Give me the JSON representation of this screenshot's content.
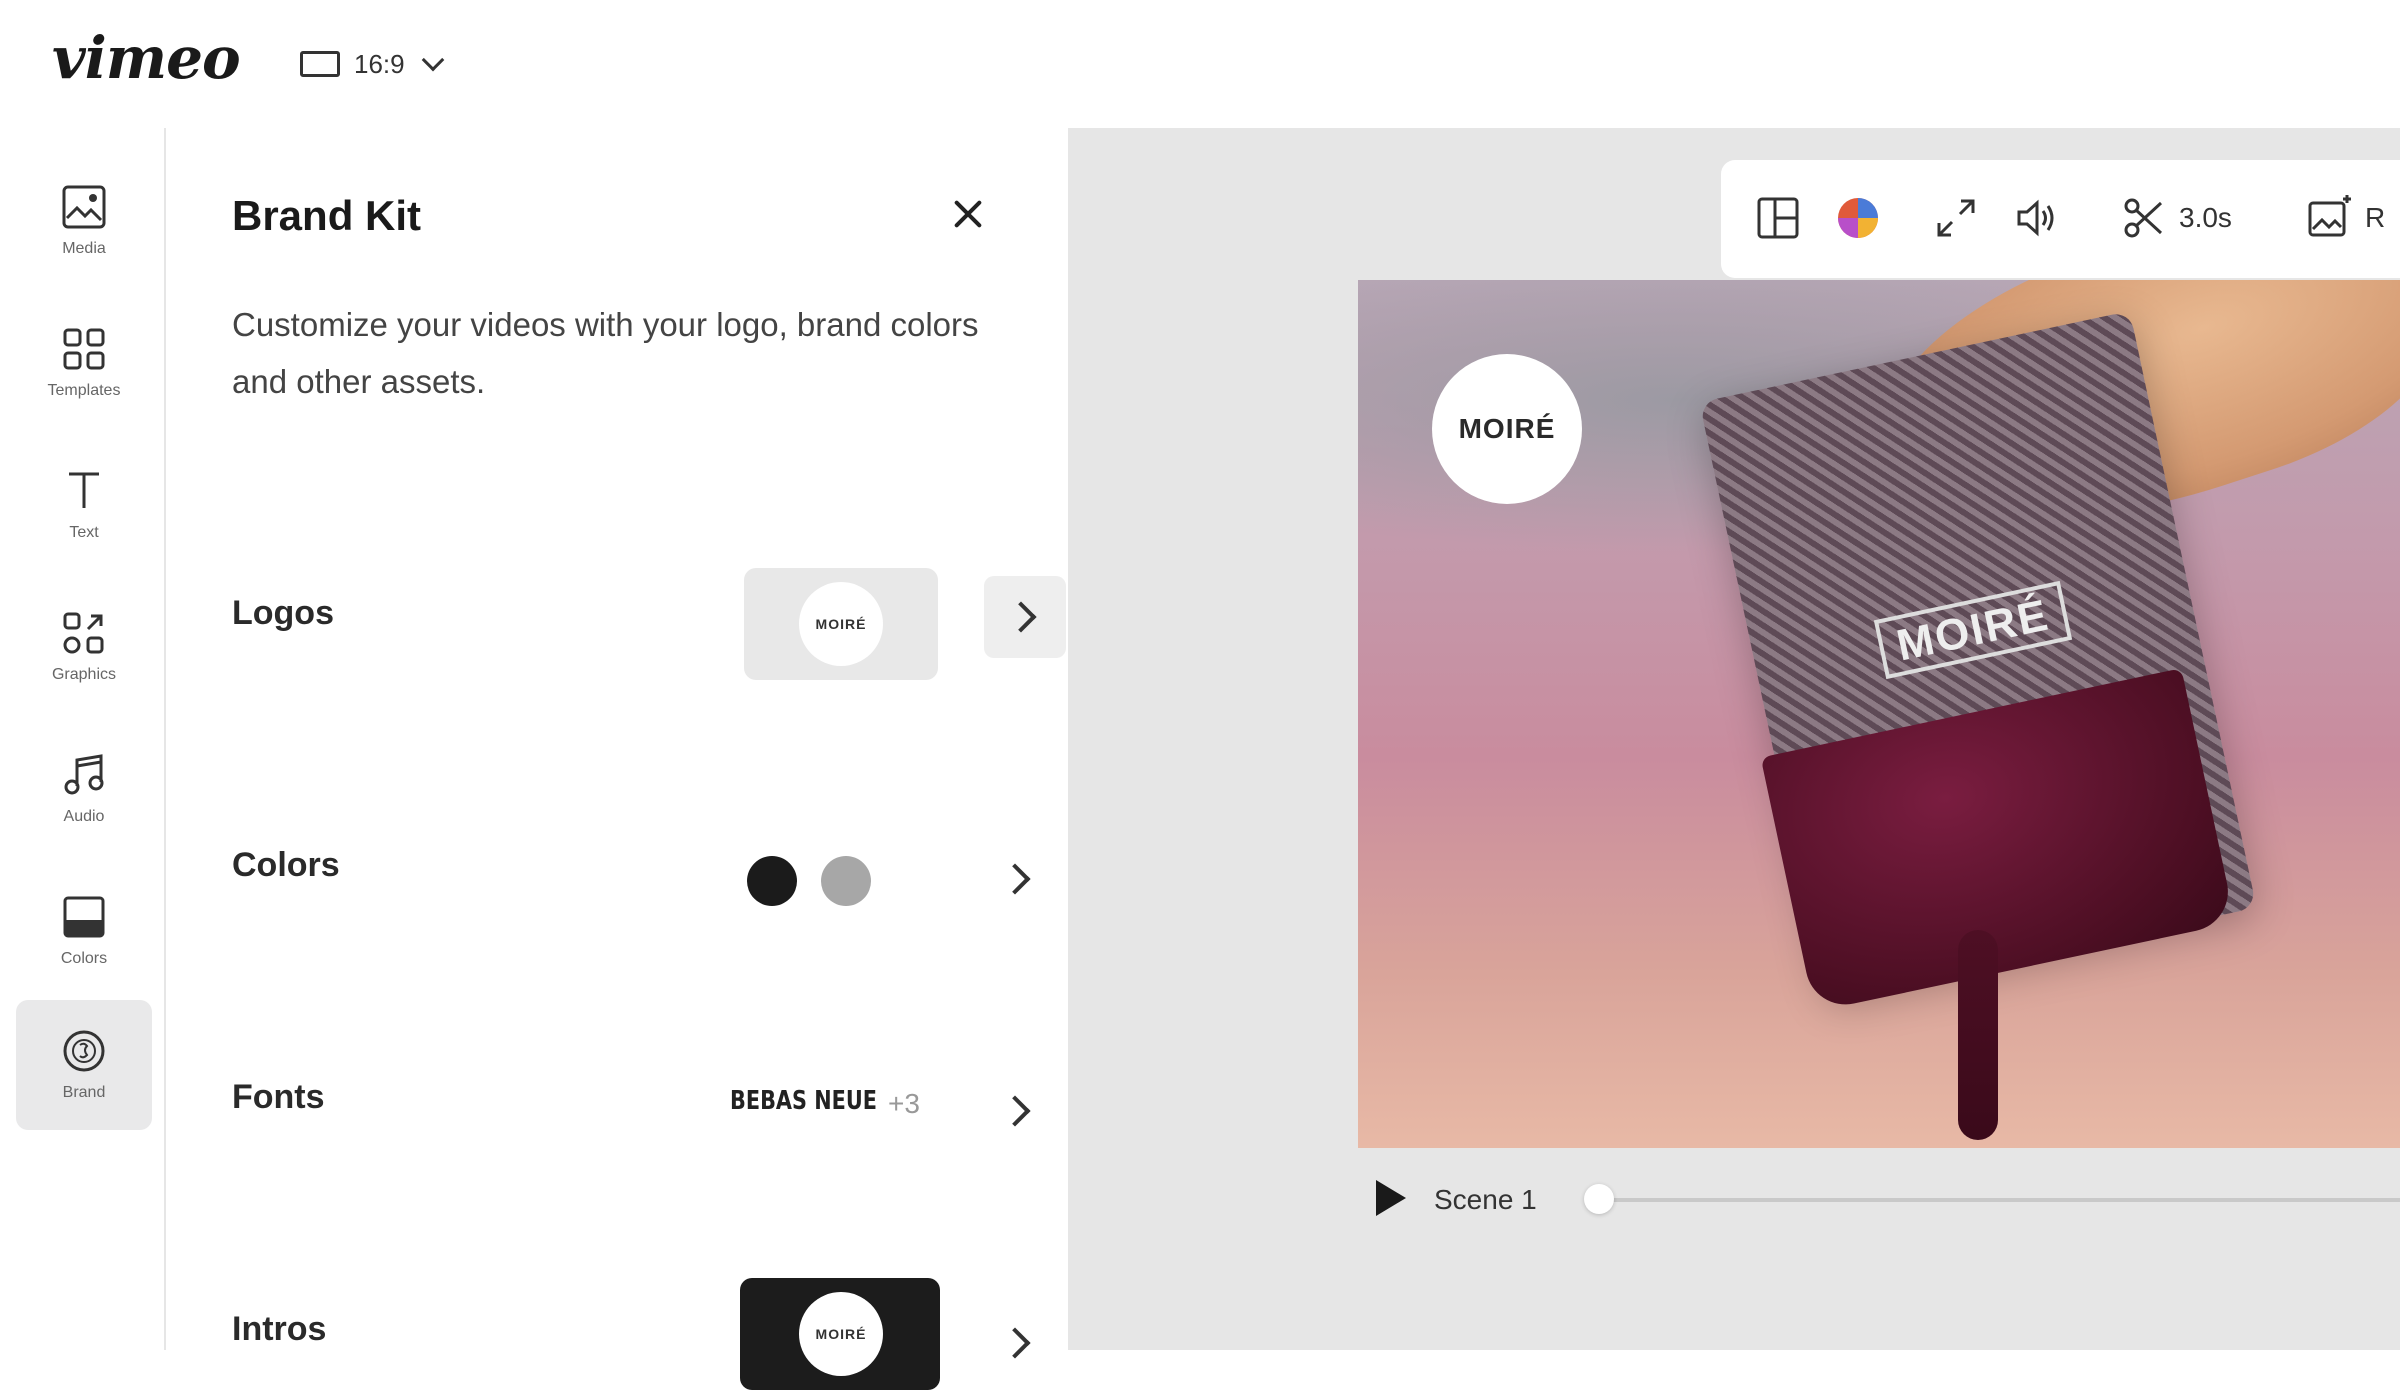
{
  "app": {
    "logo_text": "vimeo"
  },
  "topbar": {
    "aspect_ratio": "16:9"
  },
  "rail": {
    "items": [
      {
        "label": "Media",
        "icon": "image-icon"
      },
      {
        "label": "Templates",
        "icon": "grid-icon"
      },
      {
        "label": "Text",
        "icon": "text-icon"
      },
      {
        "label": "Graphics",
        "icon": "shapes-icon"
      },
      {
        "label": "Audio",
        "icon": "music-note-icon"
      },
      {
        "label": "Colors",
        "icon": "color-fill-icon"
      },
      {
        "label": "Brand",
        "icon": "brand-icon",
        "active": true
      }
    ]
  },
  "panel": {
    "title": "Brand Kit",
    "description": "Customize your videos with your logo, brand colors and other assets.",
    "rows": {
      "logos": {
        "label": "Logos",
        "thumb_text": "MOIRÉ"
      },
      "colors": {
        "label": "Colors",
        "swatches": [
          "#1b1b1b",
          "#a7a7a7"
        ]
      },
      "fonts": {
        "label": "Fonts",
        "sample": "BEBAS NEUE",
        "more": "+3"
      },
      "intros": {
        "label": "Intros",
        "thumb_text": "MOIRÉ"
      }
    }
  },
  "toolbar": {
    "duration": "3.0s",
    "replace_partial": "R"
  },
  "video": {
    "brand_text": "MOIRÉ",
    "bag_text": "MOIRÉ"
  },
  "scene": {
    "label": "Scene 1"
  }
}
